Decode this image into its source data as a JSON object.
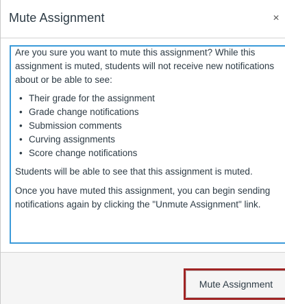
{
  "dialog": {
    "title": "Mute Assignment",
    "close_glyph": "×",
    "close_icon": "close-icon"
  },
  "content": {
    "intro": "Are you sure you want to mute this assignment? While this assignment is muted, students will not receive new notifications about or be able to see:",
    "bullets": [
      "Their grade for the assignment",
      "Grade change notifications",
      "Submission comments",
      "Curving assignments",
      "Score change notifications"
    ],
    "bullet_glyph": "•",
    "visibility_note": "Students will be able to see that this assignment is muted.",
    "unmute_note": "Once you have muted this assignment, you can begin sending notifications again by clicking the \"Unmute Assignment\" link."
  },
  "footer": {
    "mute_button_label": "Mute Assignment"
  },
  "colors": {
    "focus_outline": "#3a9ad9",
    "highlight_box": "#a02424",
    "footer_bg": "#f5f5f5",
    "text": "#2d3b45"
  }
}
